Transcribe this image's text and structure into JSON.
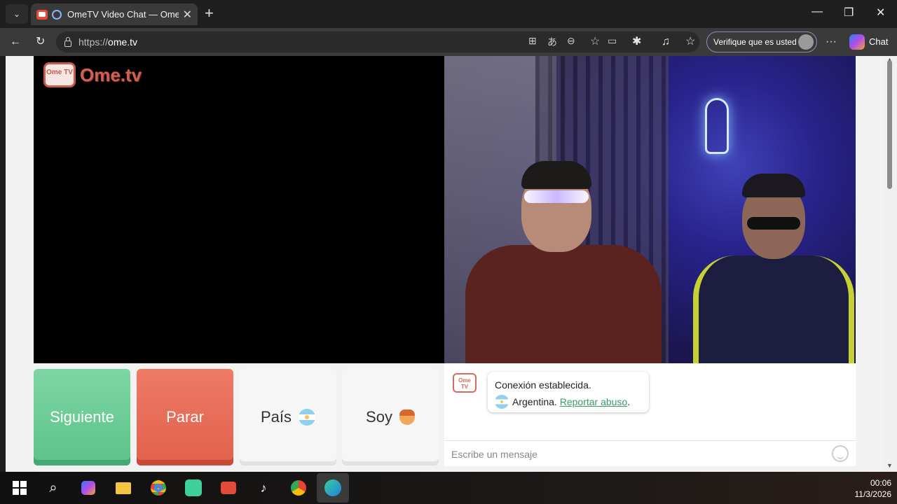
{
  "browser": {
    "tab_title": "OmeTV Video Chat — Omegle",
    "tab_close": "✕",
    "new_tab": "+",
    "url_prefix": "https://",
    "url_domain": "ome.tv",
    "profile_button": "Verifique que es usted",
    "chat_button": "Chat",
    "window_controls": {
      "minimize": "—",
      "restore": "❐",
      "close": "✕"
    }
  },
  "video": {
    "logo_badge": "Ome TV",
    "logo_text": "Ome.tv"
  },
  "controls": {
    "next_label": "Siguiente",
    "stop_label": "Parar",
    "country_label": "País",
    "gender_label": "Soy"
  },
  "chat": {
    "logo_badge": "Ome TV",
    "status_line": "Conexión establecida.",
    "country_name": "Argentina.",
    "report_link": "Reportar abuso",
    "report_suffix": ".",
    "input_placeholder": "Escribe un mensaje"
  },
  "taskbar": {
    "time": "00:06",
    "date": "11/3/2026"
  },
  "colors": {
    "next": "#5cc28a",
    "stop": "#e1614c",
    "brand": "#d06052",
    "link": "#3a9a6a"
  },
  "icons": [
    "tab-menu-icon",
    "back-icon",
    "refresh-icon",
    "lock-icon",
    "star-icon",
    "extensions-icon",
    "favorites-icon",
    "more-icon",
    "copilot-icon",
    "argentina-flag-icon",
    "boy-emoji-icon",
    "emoji-icon",
    "windows-start-icon",
    "search-icon",
    "chrome-icon",
    "edge-icon",
    "tiktok-icon"
  ]
}
